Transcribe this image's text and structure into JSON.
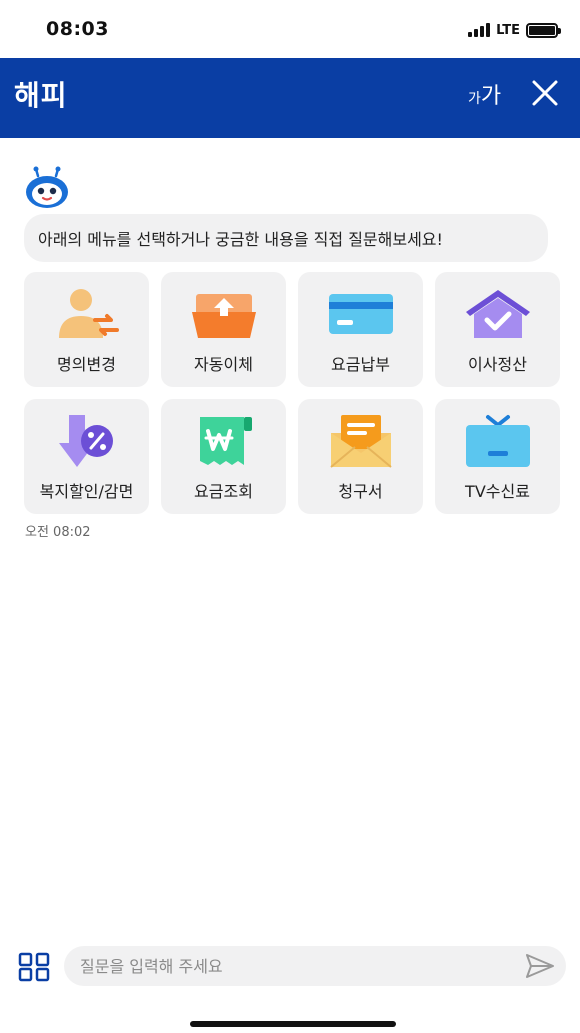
{
  "status_bar": {
    "time": "08:03",
    "network": "LTE",
    "battery_level": 1.0
  },
  "header": {
    "logo": "해피",
    "font_size_small": "가",
    "font_size_large": "가",
    "close_icon": "close-icon",
    "background_color": "#0a3ea4"
  },
  "chat": {
    "bot_avatar_icon": "bot-robot-icon",
    "bot_message": "아래의 메뉴를 선택하거나 궁금한 내용을 직접 질문해보세요!",
    "message_time": "오전 08:02",
    "menu_items": [
      {
        "label": "명의변경",
        "icon": "name-change-icon"
      },
      {
        "label": "자동이체",
        "icon": "auto-transfer-icon"
      },
      {
        "label": "요금납부",
        "icon": "credit-card-icon"
      },
      {
        "label": "이사정산",
        "icon": "house-check-icon"
      },
      {
        "label": "복지할인/감면",
        "icon": "discount-icon"
      },
      {
        "label": "요금조회",
        "icon": "bill-won-icon"
      },
      {
        "label": "청구서",
        "icon": "envelope-letter-icon"
      },
      {
        "label": "TV수신료",
        "icon": "tv-icon"
      }
    ]
  },
  "input_bar": {
    "placeholder": "질문을 입력해 주세요",
    "value": "",
    "menu_icon": "grid-menu-icon",
    "send_icon": "send-icon"
  }
}
